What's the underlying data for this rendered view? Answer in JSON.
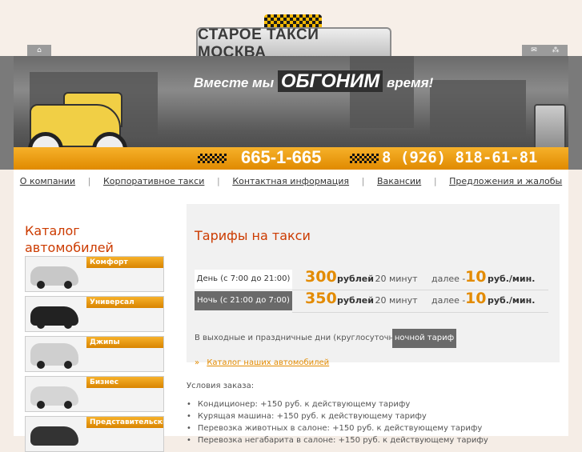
{
  "header": {
    "logo_text": "СТАРОЕ ТАКСИ МОСКВА",
    "home_icon": "home-icon",
    "mail_icon": "mail-icon",
    "sitemap_icon": "sitemap-icon"
  },
  "banner": {
    "slogan_left": "Вместе мы",
    "slogan_big": "ОБГОНИМ",
    "slogan_right": "время!",
    "phone_main": "665-1-665",
    "phone_mobile": "8 (926) 818-61-81"
  },
  "nav": {
    "items": [
      {
        "label": "О компании"
      },
      {
        "label": "Корпоративное такси"
      },
      {
        "label": "Контактная информация"
      },
      {
        "label": "Вакансии"
      },
      {
        "label": "Предложения и жалобы"
      }
    ]
  },
  "sidebar": {
    "title_line1": "Каталог",
    "title_line2": "автомобилей",
    "cars": [
      {
        "label": "Комфорт",
        "color": "#c8c8c8"
      },
      {
        "label": "Универсал",
        "color": "#222222"
      },
      {
        "label": "Джипы",
        "color": "#cfcfcf"
      },
      {
        "label": "Бизнес",
        "color": "#d5d5d5"
      },
      {
        "label": "Представительский",
        "color": "#333333"
      }
    ]
  },
  "tariffs": {
    "title": "Тарифы на такси",
    "day": {
      "label": "День (с 7:00 до 21:00)",
      "price": "300",
      "price_unit": "рублей",
      "per": "- 20 минут",
      "further_label": "далее -",
      "further_price": "10",
      "further_unit": "руб./мин."
    },
    "night": {
      "label": "Ночь (с 21:00 до 7:00)",
      "price": "350",
      "price_unit": "рублей",
      "per": "- 20 минут",
      "further_label": "далее -",
      "further_price": "10",
      "further_unit": "руб./мин."
    },
    "holiday_text": "В выходные и праздничные дни (круглосуточно) —",
    "holiday_button": "ночной тариф",
    "catalog_link": "Каталог наших автомобилей"
  },
  "conditions": {
    "title": "Условия заказа:",
    "items": [
      "Кондиционер: +150 руб. к действующему тарифу",
      "Курящая машина: +150 руб. к действующему тарифу",
      "Перевозка животных в салоне: +150 руб. к действующему тарифу",
      "Перевозка негабарита в салоне: +150 руб. к действующему тарифу"
    ]
  },
  "colors": {
    "accent": "#e38b00",
    "title": "#cc3b00"
  }
}
